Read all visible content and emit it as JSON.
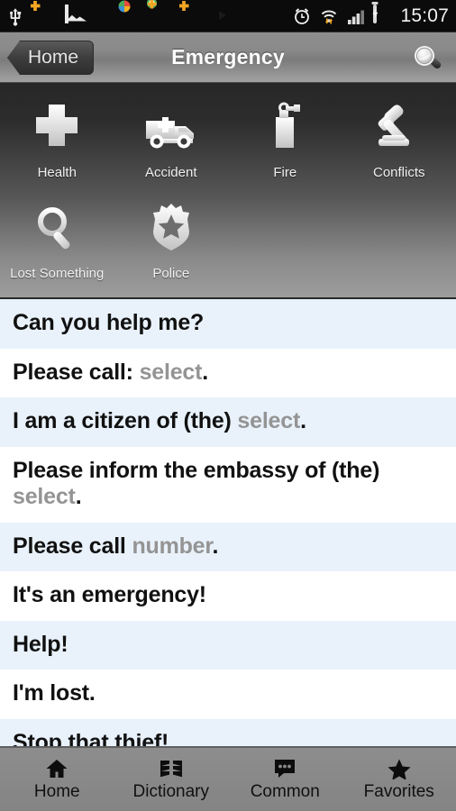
{
  "statusbar": {
    "time": "15:07",
    "left_icons": [
      {
        "name": "usb-icon"
      },
      {
        "name": "plugin-update-icon"
      },
      {
        "name": "gallery-icon"
      },
      {
        "name": "orange-dot-icon"
      },
      {
        "name": "clipboard-color-icon"
      },
      {
        "name": "plugin-installed-icon"
      },
      {
        "name": "plugin-update-icon-2"
      },
      {
        "name": "play-store-icon"
      }
    ],
    "right_icons": [
      {
        "name": "alarm-icon"
      },
      {
        "name": "wifi-icon"
      },
      {
        "name": "signal-icon"
      },
      {
        "name": "battery-charging-icon"
      }
    ]
  },
  "titlebar": {
    "back_label": "Home",
    "title": "Emergency",
    "search_icon": "magnifier-icon"
  },
  "categories": [
    {
      "label": "Health",
      "icon": "medical-cross-icon"
    },
    {
      "label": "Accident",
      "icon": "ambulance-icon"
    },
    {
      "label": "Fire",
      "icon": "fire-extinguisher-icon"
    },
    {
      "label": "Conflicts",
      "icon": "gavel-icon"
    },
    {
      "label": "Lost Something",
      "icon": "magnifier-icon"
    },
    {
      "label": "Police",
      "icon": "police-badge-icon"
    }
  ],
  "phrases": [
    {
      "parts": [
        {
          "text": "Can you help me?",
          "type": "text"
        }
      ]
    },
    {
      "parts": [
        {
          "text": "Please call: ",
          "type": "text"
        },
        {
          "text": "select",
          "type": "slot"
        },
        {
          "text": ".",
          "type": "text"
        }
      ]
    },
    {
      "parts": [
        {
          "text": "I am a citizen of (the) ",
          "type": "text"
        },
        {
          "text": "select",
          "type": "slot"
        },
        {
          "text": ".",
          "type": "text"
        }
      ]
    },
    {
      "parts": [
        {
          "text": "Please inform the embassy of (the) ",
          "type": "text"
        },
        {
          "text": "select",
          "type": "slot"
        },
        {
          "text": ".",
          "type": "text"
        }
      ]
    },
    {
      "parts": [
        {
          "text": "Please call ",
          "type": "text"
        },
        {
          "text": "number",
          "type": "slot"
        },
        {
          "text": ".",
          "type": "text"
        }
      ]
    },
    {
      "parts": [
        {
          "text": "It's an emergency!",
          "type": "text"
        }
      ]
    },
    {
      "parts": [
        {
          "text": "Help!",
          "type": "text"
        }
      ]
    },
    {
      "parts": [
        {
          "text": "I'm lost.",
          "type": "text"
        }
      ]
    },
    {
      "parts": [
        {
          "text": "Stop that thief!",
          "type": "text"
        }
      ]
    }
  ],
  "bottom_nav": [
    {
      "label": "Home",
      "icon": "home-icon"
    },
    {
      "label": "Dictionary",
      "icon": "book-pages-icon"
    },
    {
      "label": "Common",
      "icon": "speech-bubble-icon"
    },
    {
      "label": "Favorites",
      "icon": "star-icon"
    }
  ],
  "colors": {
    "row_alt": "#e9f2fb",
    "slot_text": "#949494",
    "title_text": "#ffffff",
    "nav_bg": "#8a8a8a"
  }
}
